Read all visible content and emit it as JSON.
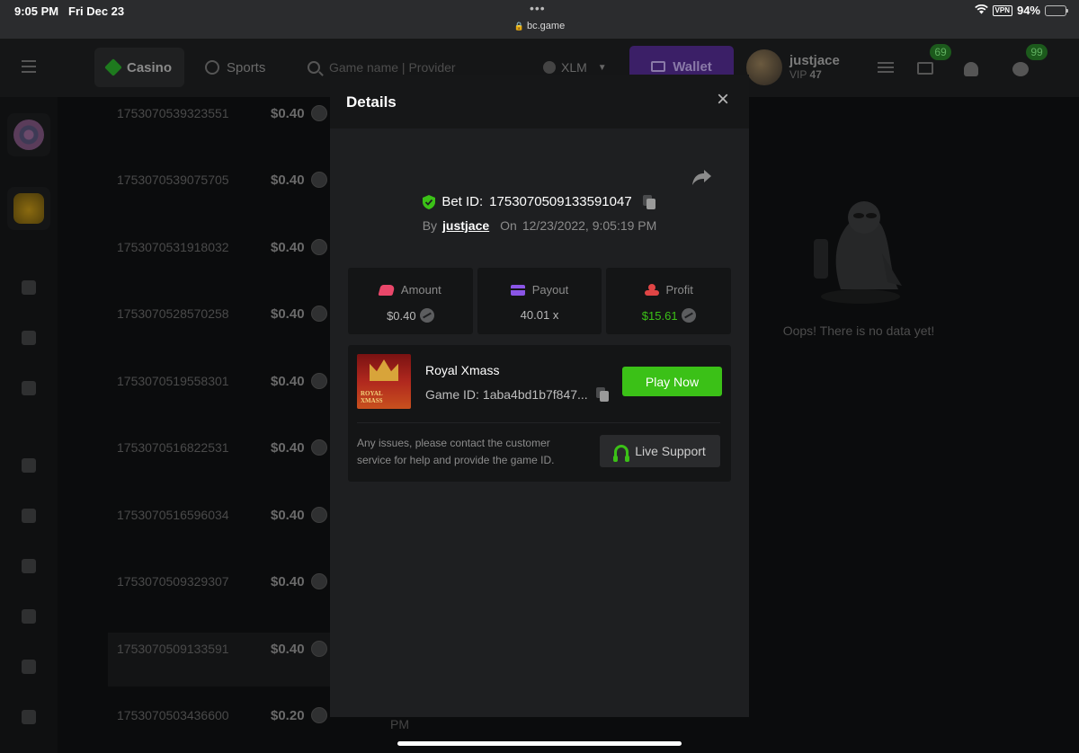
{
  "status_bar": {
    "time": "9:05 PM",
    "date": "Fri Dec 23",
    "dots": "•••",
    "url": "bc.game",
    "vpn": "VPN",
    "battery": "94%"
  },
  "header": {
    "tabs": [
      {
        "label": "Casino",
        "icon": "casino-diamond-icon"
      },
      {
        "label": "Sports",
        "icon": "sports-ball-icon"
      }
    ],
    "search_placeholder": "Game name | Provider",
    "currency": "XLM",
    "wallet_label": "Wallet",
    "user": {
      "name": "justjace",
      "vip_prefix": "VIP",
      "vip_level": "47"
    },
    "badges": {
      "mail": "69",
      "chat": "99"
    }
  },
  "background_list": {
    "rows": [
      {
        "id": "1753070539323551",
        "amount": "$0.40"
      },
      {
        "id": "1753070539075705",
        "amount": "$0.40"
      },
      {
        "id": "1753070531918032",
        "amount": "$0.40"
      },
      {
        "id": "1753070528570258",
        "amount": "$0.40"
      },
      {
        "id": "1753070519558301",
        "amount": "$0.40"
      },
      {
        "id": "1753070516822531",
        "amount": "$0.40"
      },
      {
        "id": "1753070516596034",
        "amount": "$0.40"
      },
      {
        "id": "1753070509329307",
        "amount": "$0.40"
      },
      {
        "id": "1753070509133591",
        "amount": "$0.40"
      },
      {
        "id": "1753070503436600",
        "amount": "$0.20"
      }
    ],
    "trailing_pm": "PM",
    "empty_text": "Oops! There is no data yet!"
  },
  "modal": {
    "title": "Details",
    "bet_label": "Bet ID:",
    "bet_id": "1753070509133591047",
    "by_label": "By",
    "user": "justjace",
    "on_label": "On",
    "datetime": "12/23/2022, 9:05:19 PM",
    "stats": [
      {
        "label": "Amount",
        "value": "$0.40"
      },
      {
        "label": "Payout",
        "value": "40.01 x"
      },
      {
        "label": "Profit",
        "value": "$15.61"
      }
    ],
    "game": {
      "name": "Royal Xmass",
      "id_label": "Game ID:",
      "id": "1aba4bd1b7f847...",
      "thumb_line1": "ROYAL",
      "thumb_line2": "XMASS",
      "play_label": "Play Now"
    },
    "note": "Any issues, please contact the customer service for help and provide the game ID.",
    "support_label": "Live Support"
  },
  "colors": {
    "accent_green": "#3bc117",
    "wallet_purple": "#3b1f67",
    "amount_pink": "#e9476a",
    "payout_purple": "#8a55e6",
    "profit_red": "#e04545"
  }
}
